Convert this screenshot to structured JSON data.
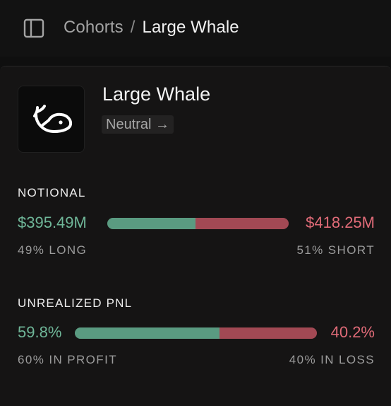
{
  "header": {
    "breadcrumb_parent": "Cohorts",
    "separator": "/",
    "breadcrumb_current": "Large Whale"
  },
  "cohort": {
    "name": "Large Whale",
    "sentiment": "Neutral →",
    "icon": "whale-icon"
  },
  "notional": {
    "label": "NOTIONAL",
    "long_value": "$395.49M",
    "short_value": "$418.25M",
    "long_pct_label": "49% LONG",
    "short_pct_label": "51% SHORT",
    "long_fraction": 0.486
  },
  "pnl": {
    "label": "UNREALIZED PNL",
    "profit_value": "59.8%",
    "loss_value": "40.2%",
    "profit_label": "60% IN PROFIT",
    "loss_label": "40% IN LOSS",
    "profit_fraction": 0.598
  },
  "colors": {
    "long": "#6fb698",
    "short": "#e06b78",
    "bar_green": "#5a9b81",
    "bar_red": "#a24954"
  }
}
